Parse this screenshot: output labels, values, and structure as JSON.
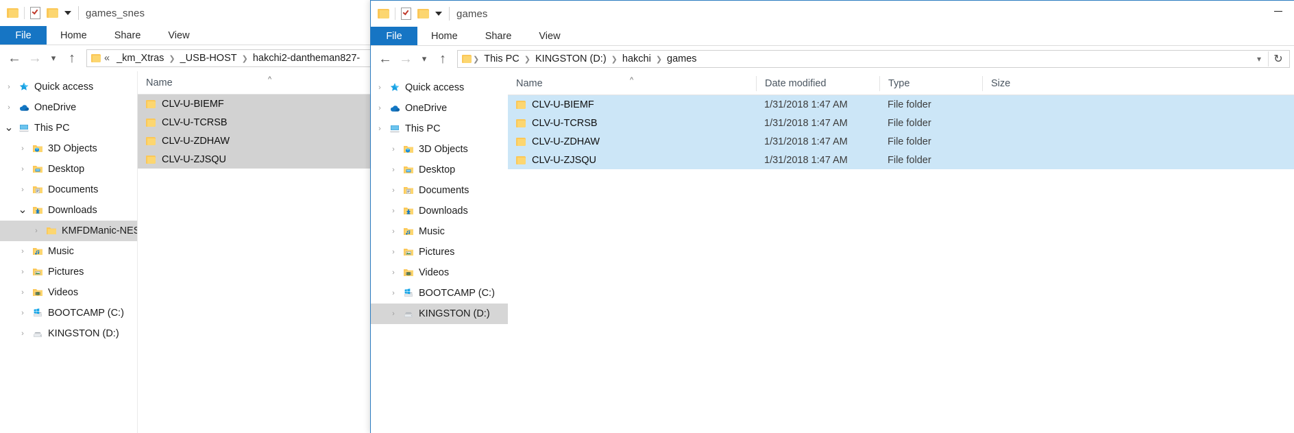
{
  "left_window": {
    "title": "games_snes",
    "quick_access_icons": [
      "folder-icon",
      "properties-icon",
      "new-folder-icon",
      "customize-dropdown-icon"
    ],
    "ribbon_tabs": [
      {
        "label": "File",
        "active": true
      },
      {
        "label": "Home",
        "active": false
      },
      {
        "label": "Share",
        "active": false
      },
      {
        "label": "View",
        "active": false
      }
    ],
    "address": {
      "overflow_label": "«",
      "crumbs": [
        "_km_Xtras",
        "_USB-HOST",
        "hakchi2-dantheman827-"
      ]
    },
    "nav_pane": [
      {
        "label": "Quick access",
        "icon": "star-icon",
        "indent": 0,
        "chevron": "collapsed",
        "selected": false
      },
      {
        "label": "OneDrive",
        "icon": "cloud-icon",
        "indent": 0,
        "chevron": "collapsed",
        "selected": false
      },
      {
        "label": "This PC",
        "icon": "pc-icon",
        "indent": 0,
        "chevron": "expanded",
        "selected": false
      },
      {
        "label": "3D Objects",
        "icon": "folder-3d-icon",
        "indent": 1,
        "chevron": "collapsed",
        "selected": false
      },
      {
        "label": "Desktop",
        "icon": "folder-desktop-icon",
        "indent": 1,
        "chevron": "collapsed",
        "selected": false
      },
      {
        "label": "Documents",
        "icon": "folder-documents-icon",
        "indent": 1,
        "chevron": "collapsed",
        "selected": false
      },
      {
        "label": "Downloads",
        "icon": "folder-downloads-icon",
        "indent": 1,
        "chevron": "expanded",
        "selected": false
      },
      {
        "label": "KMFDManic-NESC",
        "icon": "folder-icon",
        "indent": 2,
        "chevron": "collapsed",
        "selected": true
      },
      {
        "label": "Music",
        "icon": "folder-music-icon",
        "indent": 1,
        "chevron": "collapsed",
        "selected": false
      },
      {
        "label": "Pictures",
        "icon": "folder-pictures-icon",
        "indent": 1,
        "chevron": "collapsed",
        "selected": false
      },
      {
        "label": "Videos",
        "icon": "folder-videos-icon",
        "indent": 1,
        "chevron": "collapsed",
        "selected": false
      },
      {
        "label": "BOOTCAMP (C:)",
        "icon": "drive-windows-icon",
        "indent": 1,
        "chevron": "collapsed",
        "selected": false
      },
      {
        "label": "KINGSTON (D:)",
        "icon": "drive-icon",
        "indent": 1,
        "chevron": "collapsed",
        "selected": false
      }
    ],
    "columns": [
      {
        "label": "Name"
      }
    ],
    "rows": [
      {
        "name": "CLV-U-BIEMF",
        "selected": true
      },
      {
        "name": "CLV-U-TCRSB",
        "selected": true
      },
      {
        "name": "CLV-U-ZDHAW",
        "selected": true
      },
      {
        "name": "CLV-U-ZJSQU",
        "selected": true
      }
    ]
  },
  "right_window": {
    "title": "games",
    "quick_access_icons": [
      "folder-icon",
      "properties-icon",
      "new-folder-icon",
      "customize-dropdown-icon"
    ],
    "minimize_label": "—",
    "ribbon_tabs": [
      {
        "label": "File",
        "active": true
      },
      {
        "label": "Home",
        "active": false
      },
      {
        "label": "Share",
        "active": false
      },
      {
        "label": "View",
        "active": false
      }
    ],
    "address": {
      "crumbs": [
        "This PC",
        "KINGSTON (D:)",
        "hakchi",
        "games"
      ],
      "dropdown_icon": "chevron-down-icon",
      "refresh_icon": "refresh-icon"
    },
    "nav_pane": [
      {
        "label": "Quick access",
        "icon": "star-icon",
        "indent": 0,
        "selected": false
      },
      {
        "label": "OneDrive",
        "icon": "cloud-icon",
        "indent": 0,
        "selected": false
      },
      {
        "label": "This PC",
        "icon": "pc-icon",
        "indent": 0,
        "selected": false
      },
      {
        "label": "3D Objects",
        "icon": "folder-3d-icon",
        "indent": 1,
        "selected": false
      },
      {
        "label": "Desktop",
        "icon": "folder-desktop-icon",
        "indent": 1,
        "selected": false
      },
      {
        "label": "Documents",
        "icon": "folder-documents-icon",
        "indent": 1,
        "selected": false
      },
      {
        "label": "Downloads",
        "icon": "folder-downloads-icon",
        "indent": 1,
        "selected": false
      },
      {
        "label": "Music",
        "icon": "folder-music-icon",
        "indent": 1,
        "selected": false
      },
      {
        "label": "Pictures",
        "icon": "folder-pictures-icon",
        "indent": 1,
        "selected": false
      },
      {
        "label": "Videos",
        "icon": "folder-videos-icon",
        "indent": 1,
        "selected": false
      },
      {
        "label": "BOOTCAMP (C:)",
        "icon": "drive-windows-icon",
        "indent": 1,
        "selected": false
      },
      {
        "label": "KINGSTON (D:)",
        "icon": "drive-icon",
        "indent": 1,
        "selected": true
      }
    ],
    "columns": [
      {
        "label": "Name"
      },
      {
        "label": "Date modified"
      },
      {
        "label": "Type"
      },
      {
        "label": "Size"
      }
    ],
    "rows": [
      {
        "name": "CLV-U-BIEMF",
        "date_modified": "1/31/2018 1:47 AM",
        "type": "File folder",
        "size": "",
        "selected": true
      },
      {
        "name": "CLV-U-TCRSB",
        "date_modified": "1/31/2018 1:47 AM",
        "type": "File folder",
        "size": "",
        "selected": true
      },
      {
        "name": "CLV-U-ZDHAW",
        "date_modified": "1/31/2018 1:47 AM",
        "type": "File folder",
        "size": "",
        "selected": true
      },
      {
        "name": "CLV-U-ZJSQU",
        "date_modified": "1/31/2018 1:47 AM",
        "type": "File folder",
        "size": "",
        "selected": true
      }
    ]
  },
  "colors": {
    "accent_blue": "#1675c4",
    "selection_active": "#cce6f7",
    "selection_inactive": "#d2d2d2",
    "folder_yellow": "#fbc757"
  }
}
